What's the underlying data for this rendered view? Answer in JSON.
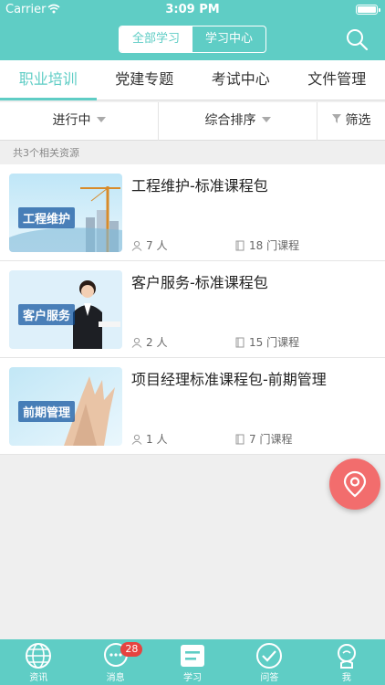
{
  "status": {
    "carrier": "Carrier",
    "time": "3:09 PM"
  },
  "header": {
    "seg_all": "全部学习",
    "seg_center": "学习中心"
  },
  "tabs": [
    "职业培训",
    "党建专题",
    "考试中心",
    "文件管理"
  ],
  "filters": {
    "status": "进行中",
    "sort": "综合排序",
    "filter": "筛选"
  },
  "count_text": "共3个相关资源",
  "items": [
    {
      "title": "工程维护-标准课程包",
      "people": "7 人",
      "courses": "18 门课程",
      "thumb_label": "工程维护"
    },
    {
      "title": "客户服务-标准课程包",
      "people": "2 人",
      "courses": "15 门课程",
      "thumb_label": "客户服务"
    },
    {
      "title": "项目经理标准课程包-前期管理",
      "people": "1 人",
      "courses": "7 门课程",
      "thumb_label": "前期管理"
    }
  ],
  "tabbar": {
    "news": "资讯",
    "messages": "消息",
    "messages_badge": "28",
    "study": "学习",
    "qa": "问答",
    "me": "我"
  },
  "colors": {
    "primary": "#5fcdc5",
    "fab": "#f26d6d",
    "badge": "#e64340"
  },
  "icons": [
    "wifi-icon",
    "battery-icon",
    "search-icon",
    "caret-down-icon",
    "funnel-icon",
    "person-icon",
    "book-icon",
    "location-pin-icon",
    "globe-icon",
    "chat-icon",
    "study-icon",
    "check-icon",
    "user-icon"
  ]
}
